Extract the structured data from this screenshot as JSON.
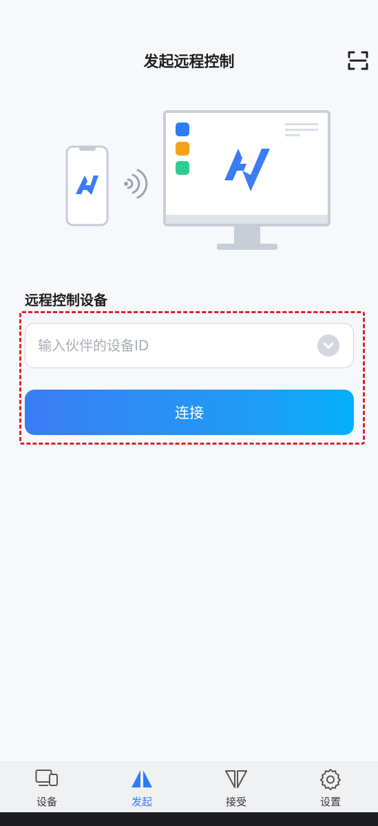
{
  "header": {
    "title": "发起远程控制",
    "scan_icon": "scan-icon"
  },
  "section": {
    "title": "远程控制设备"
  },
  "device_input": {
    "value": "",
    "placeholder": "输入伙伴的设备ID",
    "dropdown_icon": "chevron-down-icon"
  },
  "connect_button": {
    "label": "连接"
  },
  "bottom_nav": {
    "items": [
      {
        "label": "设备",
        "icon": "devices-icon",
        "active": false
      },
      {
        "label": "发起",
        "icon": "initiate-icon",
        "active": true
      },
      {
        "label": "接受",
        "icon": "accept-icon",
        "active": false
      },
      {
        "label": "设置",
        "icon": "gear-icon",
        "active": false
      }
    ]
  },
  "colors": {
    "accent": "#2f7df6",
    "brand_logo": "#3a7cf5",
    "highlight_frame": "#d9232a",
    "app_tile_blue": "#2f7df6",
    "app_tile_orange": "#f7a21b",
    "app_tile_green": "#2ecc8f"
  }
}
